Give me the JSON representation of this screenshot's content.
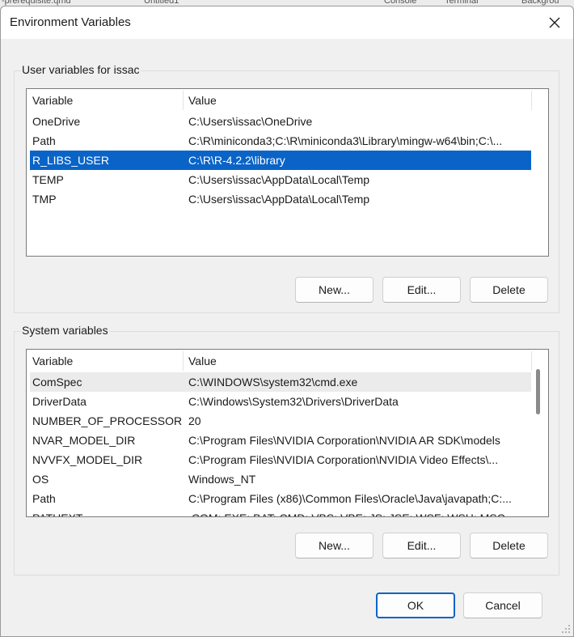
{
  "background": {
    "tabs": [
      "-prerequisite.qmd",
      "Untitled1",
      "Console",
      "Terminal",
      "Backgrou"
    ]
  },
  "window": {
    "title": "Environment Variables",
    "close_glyph": "✕"
  },
  "user_vars": {
    "group_label": "User variables for issac",
    "columns": [
      "Variable",
      "Value"
    ],
    "rows": [
      {
        "name": "OneDrive",
        "value": "C:\\Users\\issac\\OneDrive"
      },
      {
        "name": "Path",
        "value": "C:\\R\\miniconda3;C:\\R\\miniconda3\\Library\\mingw-w64\\bin;C:\\..."
      },
      {
        "name": "R_LIBS_USER",
        "value": "C:\\R\\R-4.2.2\\library"
      },
      {
        "name": "TEMP",
        "value": "C:\\Users\\issac\\AppData\\Local\\Temp"
      },
      {
        "name": "TMP",
        "value": "C:\\Users\\issac\\AppData\\Local\\Temp"
      }
    ],
    "selected_index": 2,
    "buttons": {
      "new": "New...",
      "edit": "Edit...",
      "delete": "Delete"
    }
  },
  "system_vars": {
    "group_label": "System variables",
    "columns": [
      "Variable",
      "Value"
    ],
    "rows": [
      {
        "name": "ComSpec",
        "value": "C:\\WINDOWS\\system32\\cmd.exe"
      },
      {
        "name": "DriverData",
        "value": "C:\\Windows\\System32\\Drivers\\DriverData"
      },
      {
        "name": "NUMBER_OF_PROCESSORS",
        "value": "20"
      },
      {
        "name": "NVAR_MODEL_DIR",
        "value": "C:\\Program Files\\NVIDIA Corporation\\NVIDIA AR SDK\\models"
      },
      {
        "name": "NVVFX_MODEL_DIR",
        "value": "C:\\Program Files\\NVIDIA Corporation\\NVIDIA Video Effects\\..."
      },
      {
        "name": "OS",
        "value": "Windows_NT"
      },
      {
        "name": "Path",
        "value": "C:\\Program Files (x86)\\Common Files\\Oracle\\Java\\javapath;C:..."
      },
      {
        "name": "PATHEXT",
        "value": ".COM;.EXE;.BAT;.CMD;.VBS;.VBE;.JS;.JSE;.WSF;.WSH;.MSC"
      }
    ],
    "hover_index": 0,
    "buttons": {
      "new": "New...",
      "edit": "Edit...",
      "delete": "Delete"
    }
  },
  "footer": {
    "ok": "OK",
    "cancel": "Cancel"
  },
  "colors": {
    "selection": "#0a64c8",
    "default_button_border": "#0a64c8"
  }
}
